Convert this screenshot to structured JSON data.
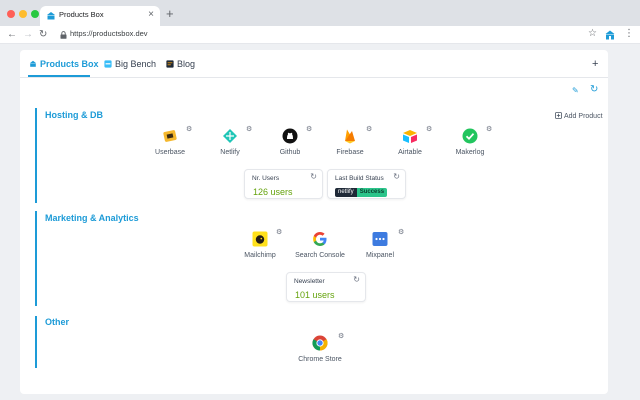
{
  "browser": {
    "tab_title": "Products Box",
    "tab_close": "×",
    "new_tab": "+",
    "url": "https://productsbox.dev",
    "icons": [
      "back-arrow-icon",
      "forward-arrow-icon",
      "reload-icon",
      "lock-icon",
      "star-icon",
      "extension-icon",
      "kebab-menu-icon"
    ]
  },
  "app": {
    "tabs": [
      {
        "label": "Products Box",
        "active": true
      },
      {
        "label": "Big Bench",
        "active": false
      },
      {
        "label": "Blog",
        "active": false
      }
    ],
    "add_tab": "+",
    "accent": "#1d9bd7",
    "value_color": "#65a30d",
    "add_product": "Add Product",
    "sections": [
      {
        "title": "Hosting & DB",
        "products": [
          "Userbase",
          "Netlify",
          "Github",
          "Firebase",
          "Airtable",
          "Makerlog"
        ],
        "metrics": [
          {
            "title": "Nr. Users",
            "value": "126 users"
          },
          {
            "title": "Last Build Status",
            "badge_left": "netlify",
            "badge_right": "Success"
          }
        ]
      },
      {
        "title": "Marketing & Analytics",
        "products": [
          "Mailchimp",
          "Search Console",
          "Mixpanel"
        ],
        "metrics": [
          {
            "title": "Newsletter",
            "value": "101 users"
          }
        ]
      },
      {
        "title": "Other",
        "products": [
          "Chrome Store"
        ],
        "metrics": []
      }
    ]
  }
}
